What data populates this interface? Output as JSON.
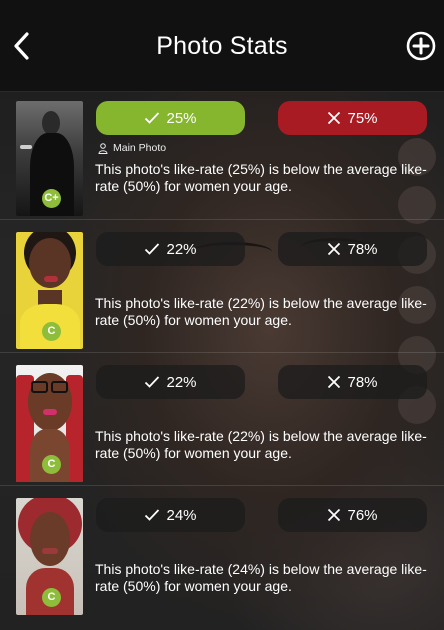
{
  "header": {
    "title": "Photo Stats",
    "back_icon": "chevron-left-icon",
    "add_icon": "plus-circle-icon"
  },
  "colors": {
    "like_active": "#86b52e",
    "dislike_active": "#a91b22",
    "inactive": "#1c1c1c",
    "badge": "#8dbd3a"
  },
  "photos": [
    {
      "like": "25%",
      "dislike": "75%",
      "badge": "C+",
      "main_photo_label": "Main Photo",
      "description": "This photo's like-rate (25%) is below the average like-rate (50%) for women your age."
    },
    {
      "like": "22%",
      "dislike": "78%",
      "badge": "C",
      "description": "This photo's like-rate (22%) is below the average like-rate (50%) for women your age."
    },
    {
      "like": "22%",
      "dislike": "78%",
      "badge": "C",
      "description": "This photo's like-rate (22%) is below the average like-rate (50%) for women your age."
    },
    {
      "like": "24%",
      "dislike": "76%",
      "badge": "C",
      "description": "This photo's like-rate (24%) is below the average like-rate (50%) for women your age."
    }
  ]
}
